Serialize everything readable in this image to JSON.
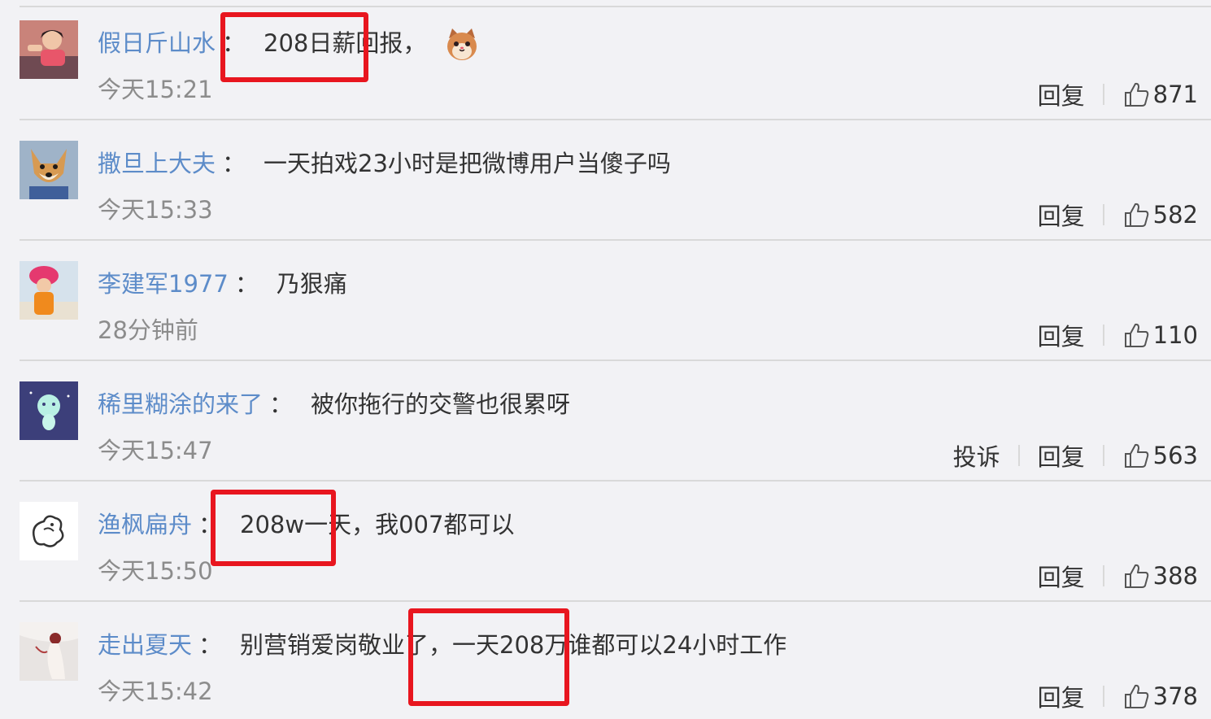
{
  "separator": "：",
  "comments": [
    {
      "username": "假日斤山水",
      "content": "208日薪回报，",
      "emoji": "cat-face-icon",
      "time": "今天15:21",
      "actions": [
        "回复"
      ],
      "likes": "871"
    },
    {
      "username": "撒旦上大夫",
      "content": "一天拍戏23小时是把微博用户当傻子吗",
      "time": "今天15:33",
      "actions": [
        "回复"
      ],
      "likes": "582"
    },
    {
      "username": "李建军1977",
      "content": "乃狠痛",
      "time": "28分钟前",
      "actions": [
        "回复"
      ],
      "likes": "110"
    },
    {
      "username": "稀里糊涂的来了",
      "content": "被你拖行的交警也很累呀",
      "time": "今天15:47",
      "actions": [
        "投诉",
        "回复"
      ],
      "likes": "563"
    },
    {
      "username": "渔枫扁舟",
      "content": "208w一天，我007都可以",
      "time": "今天15:50",
      "actions": [
        "回复"
      ],
      "likes": "388"
    },
    {
      "username": "走出夏天",
      "content": "别营销爱岗敬业了，一天208万谁都可以24小时工作",
      "time": "今天15:42",
      "actions": [
        "回复"
      ],
      "likes": "378"
    }
  ],
  "colors": {
    "background": "#f2f2f5",
    "username": "#5d8cc9",
    "text": "#333333",
    "time": "#8c8c8c",
    "highlight": "#e8161f"
  },
  "icons": {
    "like": "thumbs-up-icon"
  }
}
